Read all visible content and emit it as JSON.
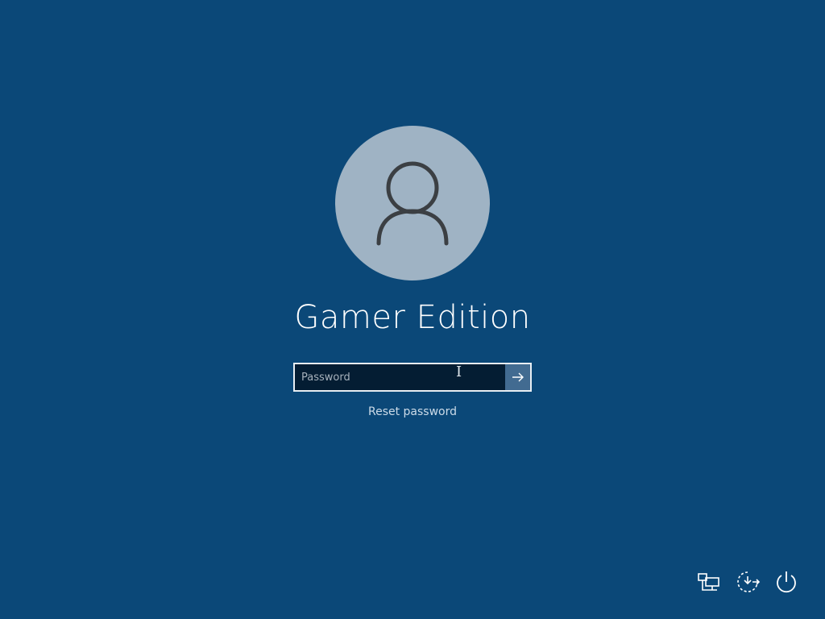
{
  "user": {
    "name": "Gamer Edition",
    "avatar_icon": "user-silhouette-icon"
  },
  "login": {
    "password_placeholder": "Password",
    "password_value": "",
    "submit_icon": "arrow-right-icon",
    "reset_label": "Reset password"
  },
  "corner_icons": [
    {
      "name": "network-icon"
    },
    {
      "name": "ease-of-access-icon"
    },
    {
      "name": "power-icon"
    }
  ],
  "colors": {
    "background": "#0b4878",
    "avatar": "#9fb3c4",
    "input_bg": "#041d33",
    "submit_bg": "#426b91"
  }
}
